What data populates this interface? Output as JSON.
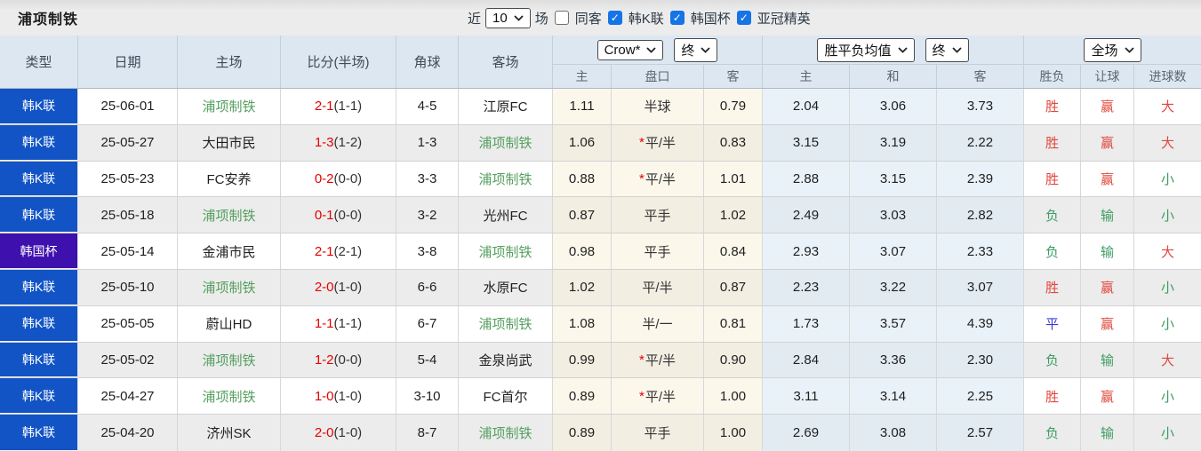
{
  "topbar": {
    "title": "浦项制铁",
    "recent_label": "近",
    "recent_count": "10",
    "matches_label": "场",
    "same_away_filter": {
      "label": "同客",
      "checked": false
    },
    "league_filters": [
      {
        "label": "韩K联",
        "checked": true
      },
      {
        "label": "韩国杯",
        "checked": true
      },
      {
        "label": "亚冠精英",
        "checked": true
      }
    ]
  },
  "header": {
    "static_columns": [
      "类型",
      "日期",
      "主场",
      "比分(半场)",
      "角球",
      "客场"
    ],
    "odds_group": {
      "provider_select": "Crow*",
      "stage_select": "终",
      "subcolumns": [
        "主",
        "盘口",
        "客"
      ]
    },
    "avg_group": {
      "provider_select": "胜平负均值",
      "stage_select": "终",
      "subcolumns": [
        "主",
        "和",
        "客"
      ]
    },
    "fulltime_group": {
      "scope_select": "全场",
      "subcolumns": [
        "胜负",
        "让球",
        "进球数"
      ]
    }
  },
  "colors": {
    "league_badge": "#1254c6",
    "cup_badge": "#3e10ad",
    "self_team_green": "#55a05f",
    "score_red": "#e60000",
    "star_red": "#e60000",
    "red": "#e0483e",
    "green": "#3d9c63",
    "blue": "#3a3ad9",
    "checkbox_blue": "#1574e6"
  },
  "rows": [
    {
      "competition": "韩K联",
      "badge": "league",
      "date": "25-06-01",
      "home": "浦项制铁",
      "home_self": true,
      "score": "2-1",
      "half": "(1-1)",
      "corners": "4-5",
      "away": "江原FC",
      "away_self": false,
      "odds_home": "1.11",
      "handicap": "半球",
      "handicap_star": false,
      "odds_away": "0.79",
      "avg_home": "2.04",
      "avg_draw": "3.06",
      "avg_away": "3.73",
      "result": "胜",
      "result_color": "red",
      "spread": "赢",
      "spread_color": "red",
      "goals": "大",
      "goals_color": "red"
    },
    {
      "competition": "韩K联",
      "badge": "league",
      "date": "25-05-27",
      "home": "大田市民",
      "home_self": false,
      "score": "1-3",
      "half": "(1-2)",
      "corners": "1-3",
      "away": "浦项制铁",
      "away_self": true,
      "odds_home": "1.06",
      "handicap": "平/半",
      "handicap_star": true,
      "odds_away": "0.83",
      "avg_home": "3.15",
      "avg_draw": "3.19",
      "avg_away": "2.22",
      "result": "胜",
      "result_color": "red",
      "spread": "赢",
      "spread_color": "red",
      "goals": "大",
      "goals_color": "red"
    },
    {
      "competition": "韩K联",
      "badge": "league",
      "date": "25-05-23",
      "home": "FC安养",
      "home_self": false,
      "score": "0-2",
      "half": "(0-0)",
      "corners": "3-3",
      "away": "浦项制铁",
      "away_self": true,
      "odds_home": "0.88",
      "handicap": "平/半",
      "handicap_star": true,
      "odds_away": "1.01",
      "avg_home": "2.88",
      "avg_draw": "3.15",
      "avg_away": "2.39",
      "result": "胜",
      "result_color": "red",
      "spread": "赢",
      "spread_color": "red",
      "goals": "小",
      "goals_color": "green"
    },
    {
      "competition": "韩K联",
      "badge": "league",
      "date": "25-05-18",
      "home": "浦项制铁",
      "home_self": true,
      "score": "0-1",
      "half": "(0-0)",
      "corners": "3-2",
      "away": "光州FC",
      "away_self": false,
      "odds_home": "0.87",
      "handicap": "平手",
      "handicap_star": false,
      "odds_away": "1.02",
      "avg_home": "2.49",
      "avg_draw": "3.03",
      "avg_away": "2.82",
      "result": "负",
      "result_color": "green",
      "spread": "输",
      "spread_color": "green",
      "goals": "小",
      "goals_color": "green"
    },
    {
      "competition": "韩国杯",
      "badge": "cup",
      "date": "25-05-14",
      "home": "金浦市民",
      "home_self": false,
      "score": "2-1",
      "half": "(2-1)",
      "corners": "3-8",
      "away": "浦项制铁",
      "away_self": true,
      "odds_home": "0.98",
      "handicap": "平手",
      "handicap_star": false,
      "odds_away": "0.84",
      "avg_home": "2.93",
      "avg_draw": "3.07",
      "avg_away": "2.33",
      "result": "负",
      "result_color": "green",
      "spread": "输",
      "spread_color": "green",
      "goals": "大",
      "goals_color": "red"
    },
    {
      "competition": "韩K联",
      "badge": "league",
      "date": "25-05-10",
      "home": "浦项制铁",
      "home_self": true,
      "score": "2-0",
      "half": "(1-0)",
      "corners": "6-6",
      "away": "水原FC",
      "away_self": false,
      "odds_home": "1.02",
      "handicap": "平/半",
      "handicap_star": false,
      "odds_away": "0.87",
      "avg_home": "2.23",
      "avg_draw": "3.22",
      "avg_away": "3.07",
      "result": "胜",
      "result_color": "red",
      "spread": "赢",
      "spread_color": "red",
      "goals": "小",
      "goals_color": "green"
    },
    {
      "competition": "韩K联",
      "badge": "league",
      "date": "25-05-05",
      "home": "蔚山HD",
      "home_self": false,
      "score": "1-1",
      "half": "(1-1)",
      "corners": "6-7",
      "away": "浦项制铁",
      "away_self": true,
      "odds_home": "1.08",
      "handicap": "半/一",
      "handicap_star": false,
      "odds_away": "0.81",
      "avg_home": "1.73",
      "avg_draw": "3.57",
      "avg_away": "4.39",
      "result": "平",
      "result_color": "blue",
      "spread": "赢",
      "spread_color": "red",
      "goals": "小",
      "goals_color": "green"
    },
    {
      "competition": "韩K联",
      "badge": "league",
      "date": "25-05-02",
      "home": "浦项制铁",
      "home_self": true,
      "score": "1-2",
      "half": "(0-0)",
      "corners": "5-4",
      "away": "金泉尚武",
      "away_self": false,
      "odds_home": "0.99",
      "handicap": "平/半",
      "handicap_star": true,
      "odds_away": "0.90",
      "avg_home": "2.84",
      "avg_draw": "3.36",
      "avg_away": "2.30",
      "result": "负",
      "result_color": "green",
      "spread": "输",
      "spread_color": "green",
      "goals": "大",
      "goals_color": "red"
    },
    {
      "competition": "韩K联",
      "badge": "league",
      "date": "25-04-27",
      "home": "浦项制铁",
      "home_self": true,
      "score": "1-0",
      "half": "(1-0)",
      "corners": "3-10",
      "away": "FC首尔",
      "away_self": false,
      "odds_home": "0.89",
      "handicap": "平/半",
      "handicap_star": true,
      "odds_away": "1.00",
      "avg_home": "3.11",
      "avg_draw": "3.14",
      "avg_away": "2.25",
      "result": "胜",
      "result_color": "red",
      "spread": "赢",
      "spread_color": "red",
      "goals": "小",
      "goals_color": "green"
    },
    {
      "competition": "韩K联",
      "badge": "league",
      "date": "25-04-20",
      "home": "济州SK",
      "home_self": false,
      "score": "2-0",
      "half": "(1-0)",
      "corners": "8-7",
      "away": "浦项制铁",
      "away_self": true,
      "odds_home": "0.89",
      "handicap": "平手",
      "handicap_star": false,
      "odds_away": "1.00",
      "avg_home": "2.69",
      "avg_draw": "3.08",
      "avg_away": "2.57",
      "result": "负",
      "result_color": "green",
      "spread": "输",
      "spread_color": "green",
      "goals": "小",
      "goals_color": "green"
    }
  ]
}
